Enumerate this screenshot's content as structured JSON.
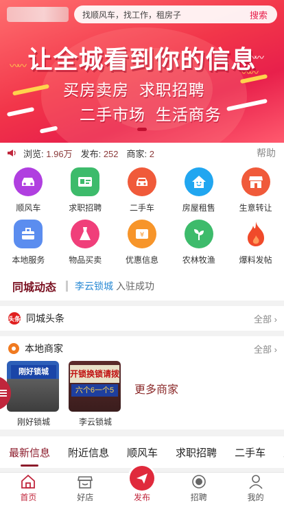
{
  "colors": {
    "brand": "#e8204b",
    "accent_dark": "#8b1a2a",
    "link": "#2a8ad4"
  },
  "search": {
    "placeholder": "找顺风车，找工作，租房子",
    "button": "搜索"
  },
  "banner": {
    "headline": "让全城看到你的信息",
    "line1": "买房卖房  求职招聘",
    "line2": "二手市场  生活商务"
  },
  "stats": {
    "views_label": "浏览:",
    "views": "1.96万",
    "posts_label": "发布:",
    "posts": "252",
    "merchants_label": "商家:",
    "merchants": "2",
    "help": "帮助"
  },
  "categories": [
    {
      "label": "顺风车",
      "icon": "car-icon",
      "color": "#b03fe0"
    },
    {
      "label": "求职招聘",
      "icon": "id-card-icon",
      "color": "#3dbb6b"
    },
    {
      "label": "二手车",
      "icon": "used-car-icon",
      "color": "#f05a3a"
    },
    {
      "label": "房屋租售",
      "icon": "house-icon",
      "color": "#21a6f0"
    },
    {
      "label": "生意转让",
      "icon": "shop-icon",
      "color": "#f05a3a"
    },
    {
      "label": "本地服务",
      "icon": "toolbox-icon",
      "color": "#5b8def"
    },
    {
      "label": "物品买卖",
      "icon": "dress-icon",
      "color": "#f03f7a"
    },
    {
      "label": "优惠信息",
      "icon": "coupon-icon",
      "color": "#f7952a"
    },
    {
      "label": "农林牧渔",
      "icon": "sprout-icon",
      "color": "#3dbb6b"
    },
    {
      "label": "爆料发帖",
      "icon": "flame-icon",
      "color": "#f04a2a"
    }
  ],
  "dynamics": {
    "title": "同城动态",
    "name": "李云锁城",
    "action": "入驻成功"
  },
  "headlines": {
    "logo_text": "头条",
    "title": "同城头条",
    "more": "全部 ›"
  },
  "merchants": {
    "title": "本地商家",
    "more": "全部 ›",
    "shops": [
      {
        "name": "刚好锁城",
        "sign": "刚好锁城"
      },
      {
        "name": "李云锁城",
        "sign": "开锁换锁请拨",
        "sign2": "六个6一个5"
      }
    ],
    "more_shops": "更多商家"
  },
  "tabs": [
    "最新信息",
    "附近信息",
    "顺风车",
    "求职招聘",
    "二手车",
    "房"
  ],
  "nav": [
    {
      "label": "首页",
      "icon": "home-icon"
    },
    {
      "label": "好店",
      "icon": "store-icon"
    },
    {
      "label": "发布",
      "icon": "send-icon"
    },
    {
      "label": "招聘",
      "icon": "hire-icon"
    },
    {
      "label": "我的",
      "icon": "user-icon"
    }
  ]
}
